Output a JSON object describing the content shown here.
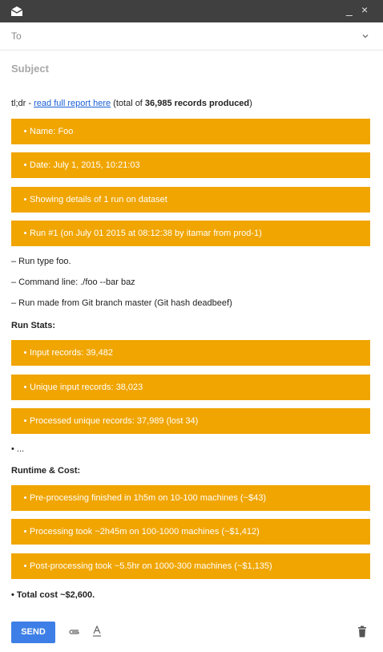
{
  "window": {
    "minimize_glyph": "_",
    "close_glyph": "×"
  },
  "compose": {
    "to_label": "To",
    "subject_placeholder": "Subject"
  },
  "email": {
    "tldr_prefix": "tl;dr - ",
    "tldr_link": "read full report here",
    "tldr_mid": " (total of ",
    "tldr_count": "36,985 records produced",
    "tldr_suffix": ")",
    "bars_top": [
      "Name: Foo",
      "Date: July 1, 2015, 10:21:03",
      "Showing details of 1 run on dataset",
      "Run #1 (on July 01 2015 at 08:12:38 by itamar from prod-1)"
    ],
    "details": [
      "– Run type foo.",
      "– Command line: ./foo --bar baz",
      "– Run made from Git branch master (Git hash deadbeef)"
    ],
    "run_stats_heading": "Run Stats:",
    "run_stats": [
      "Input records: 39,482",
      "Unique input records: 38,023",
      "Processed unique records: 37,989 (lost 34)"
    ],
    "ellipsis": "• ...",
    "runtime_heading": "Runtime & Cost:",
    "runtime": [
      "Pre-processing finished in 1h5m on 10-100 machines (~$43)",
      "Processing took ~2h45m on 100-1000 machines (~$1,412)",
      "Post-processing took ~5.5hr on 1000-300 machines (~$1,135)"
    ],
    "total": "• Total cost ~$2,600."
  },
  "toolbar": {
    "send_label": "SEND"
  },
  "colors": {
    "titlebar": "#404040",
    "bar": "#f0a500",
    "send": "#3d7fe6",
    "link": "#1a5fd6"
  }
}
